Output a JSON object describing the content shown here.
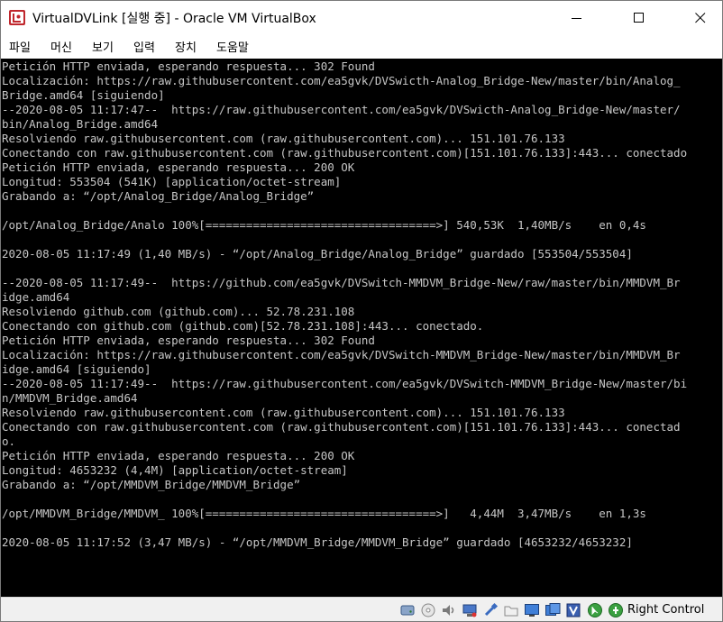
{
  "window": {
    "title": "VirtualDVLink [실행 중] - Oracle VM VirtualBox",
    "controls": {
      "minimize_icon": "minimize-icon",
      "maximize_icon": "maximize-icon",
      "close_icon": "close-icon"
    }
  },
  "menu": [
    "파일",
    "머신",
    "보기",
    "입력",
    "장치",
    "도움말"
  ],
  "terminal": {
    "lines": [
      "Petición HTTP enviada, esperando respuesta... 302 Found",
      "Localización: https://raw.githubusercontent.com/ea5gvk/DVSwicth-Analog_Bridge-New/master/bin/Analog_",
      "Bridge.amd64 [siguiendo]",
      "--2020-08-05 11:17:47--  https://raw.githubusercontent.com/ea5gvk/DVSwicth-Analog_Bridge-New/master/",
      "bin/Analog_Bridge.amd64",
      "Resolviendo raw.githubusercontent.com (raw.githubusercontent.com)... 151.101.76.133",
      "Conectando con raw.githubusercontent.com (raw.githubusercontent.com)[151.101.76.133]:443... conectado",
      "Petición HTTP enviada, esperando respuesta... 200 OK",
      "Longitud: 553504 (541K) [application/octet-stream]",
      "Grabando a: “/opt/Analog_Bridge/Analog_Bridge”",
      "",
      "/opt/Analog_Bridge/Analo 100%[==================================>] 540,53K  1,40MB/s    en 0,4s",
      "",
      "2020-08-05 11:17:49 (1,40 MB/s) - “/opt/Analog_Bridge/Analog_Bridge” guardado [553504/553504]",
      "",
      "--2020-08-05 11:17:49--  https://github.com/ea5gvk/DVSwitch-MMDVM_Bridge-New/raw/master/bin/MMDVM_Br",
      "idge.amd64",
      "Resolviendo github.com (github.com)... 52.78.231.108",
      "Conectando con github.com (github.com)[52.78.231.108]:443... conectado.",
      "Petición HTTP enviada, esperando respuesta... 302 Found",
      "Localización: https://raw.githubusercontent.com/ea5gvk/DVSwitch-MMDVM_Bridge-New/master/bin/MMDVM_Br",
      "idge.amd64 [siguiendo]",
      "--2020-08-05 11:17:49--  https://raw.githubusercontent.com/ea5gvk/DVSwitch-MMDVM_Bridge-New/master/bi",
      "n/MMDVM_Bridge.amd64",
      "Resolviendo raw.githubusercontent.com (raw.githubusercontent.com)... 151.101.76.133",
      "Conectando con raw.githubusercontent.com (raw.githubusercontent.com)[151.101.76.133]:443... conectad",
      "o.",
      "Petición HTTP enviada, esperando respuesta... 200 OK",
      "Longitud: 4653232 (4,4M) [application/octet-stream]",
      "Grabando a: “/opt/MMDVM_Bridge/MMDVM_Bridge”",
      "",
      "/opt/MMDVM_Bridge/MMDVM_ 100%[==================================>]   4,44M  3,47MB/s    en 1,3s",
      "",
      "2020-08-05 11:17:52 (3,47 MB/s) - “/opt/MMDVM_Bridge/MMDVM_Bridge” guardado [4653232/4653232]"
    ]
  },
  "statusbar": {
    "icons": [
      "hard-disk-icon",
      "optical-drive-icon",
      "audio-icon",
      "network-icon",
      "usb-icon",
      "shared-folders-icon",
      "display-icon",
      "video-capture-icon",
      "cpu-virtualization-icon",
      "mouse-integration-icon",
      "keyboard-icon"
    ],
    "host_key": "Right Control"
  }
}
